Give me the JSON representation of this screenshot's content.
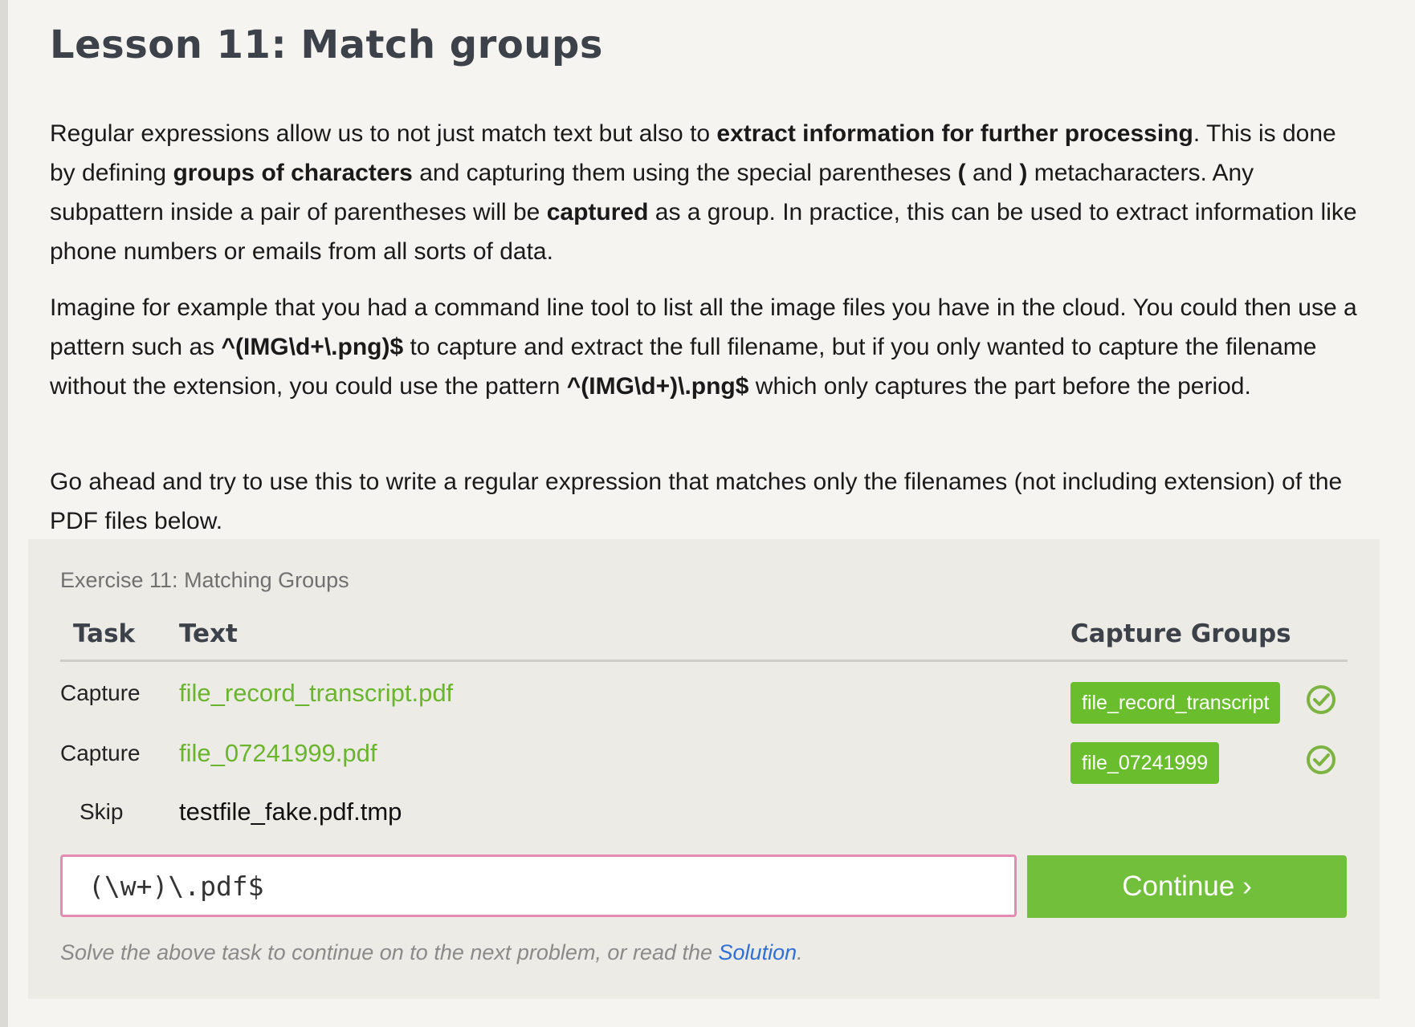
{
  "lesson": {
    "title": "Lesson 11: Match groups",
    "p1": [
      {
        "t": "Regular expressions allow us to not just match text but also to ",
        "b": false
      },
      {
        "t": "extract information for further processing",
        "b": true
      },
      {
        "t": ". This is done by defining ",
        "b": false
      },
      {
        "t": "groups of characters",
        "b": true
      },
      {
        "t": " and capturing them using the special parentheses ",
        "b": false
      },
      {
        "t": "(",
        "b": true
      },
      {
        "t": " and ",
        "b": false
      },
      {
        "t": ")",
        "b": true
      },
      {
        "t": " metacharacters. Any subpattern inside a pair of parentheses will be ",
        "b": false
      },
      {
        "t": "captured",
        "b": true
      },
      {
        "t": " as a group. In practice, this can be used to extract information like phone numbers or emails from all sorts of data.",
        "b": false
      }
    ],
    "p2": [
      {
        "t": "Imagine for example that you had a command line tool to list all the image files you have in the cloud. You could then use a pattern such as ",
        "b": false
      },
      {
        "t": "^(IMG\\d+\\.png)$",
        "b": true
      },
      {
        "t": " to capture and extract the full filename, but if you only wanted to capture the filename without the extension, you could use the pattern ",
        "b": false
      },
      {
        "t": "^(IMG\\d+)\\.png$",
        "b": true
      },
      {
        "t": " which only captures the part before the period.",
        "b": false
      }
    ],
    "p3": [
      {
        "t": "Go ahead and try to use this to write a regular expression that matches only the filenames (not including extension) of the PDF files below.",
        "b": false
      }
    ]
  },
  "exercise": {
    "title": "Exercise 11: Matching Groups",
    "headers": {
      "task": "Task",
      "text": "Text",
      "capture": "Capture Groups"
    },
    "rows": [
      {
        "task": "Capture",
        "text": "file_record_transcript.pdf",
        "capture": "file_record_transcript",
        "matched": true
      },
      {
        "task": "Capture",
        "text": "file_07241999.pdf",
        "capture": "file_07241999",
        "matched": true
      },
      {
        "task": "Skip",
        "text": "testfile_fake.pdf.tmp"
      }
    ],
    "input_value": "(\\w+)\\.pdf$",
    "continue_label": "Continue ›",
    "hint_prefix": "Solve the above task to continue on to the next problem, or read the ",
    "hint_link": "Solution",
    "hint_suffix": "."
  },
  "colors": {
    "match_text": "#6bb52e",
    "badge": "#6abe2d",
    "check": "#7cb342",
    "continue": "#72bf3c",
    "link": "#2f6fd6",
    "input_border": "#e48bb3"
  },
  "icons": {
    "row_status": "check-circle-icon"
  }
}
